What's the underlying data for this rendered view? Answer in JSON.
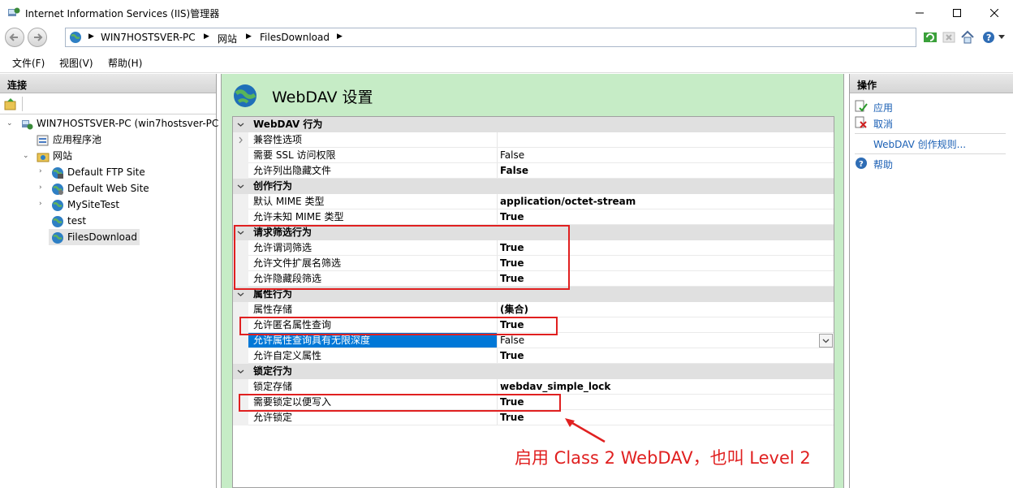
{
  "window": {
    "title": "Internet Information Services (IIS)管理器"
  },
  "address": {
    "crumbs": [
      "WIN7HOSTSVER-PC",
      "网站",
      "FilesDownload"
    ]
  },
  "menu": [
    "文件(F)",
    "视图(V)",
    "帮助(H)"
  ],
  "left": {
    "header": "连接",
    "tree": {
      "server": "WIN7HOSTSVER-PC (win7hostsver-PC",
      "apppools": "应用程序池",
      "sites": "网站",
      "site1": "Default FTP Site",
      "site2": "Default Web Site",
      "site3": "MySiteTest",
      "site4": "test",
      "site5": "FilesDownload"
    }
  },
  "main": {
    "title": "WebDAV 设置",
    "rows": [
      {
        "name": "WebDAV 行为",
        "value": "",
        "kind": "category"
      },
      {
        "name": "兼容性选项",
        "value": "",
        "kind": "expand"
      },
      {
        "name": "需要 SSL 访问权限",
        "value": "False",
        "kind": "normal"
      },
      {
        "name": "允许列出隐藏文件",
        "value": "False",
        "kind": "bold"
      },
      {
        "name": "创作行为",
        "value": "",
        "kind": "category"
      },
      {
        "name": "默认 MIME 类型",
        "value": "application/octet-stream",
        "kind": "bold"
      },
      {
        "name": "允许未知 MIME 类型",
        "value": "True",
        "kind": "bold"
      },
      {
        "name": "请求筛选行为",
        "value": "",
        "kind": "category"
      },
      {
        "name": "允许谓词筛选",
        "value": "True",
        "kind": "bold"
      },
      {
        "name": "允许文件扩展名筛选",
        "value": "True",
        "kind": "bold"
      },
      {
        "name": "允许隐藏段筛选",
        "value": "True",
        "kind": "bold"
      },
      {
        "name": "属性行为",
        "value": "",
        "kind": "category"
      },
      {
        "name": "属性存储",
        "value": "(集合)",
        "kind": "bold"
      },
      {
        "name": "允许匿名属性查询",
        "value": "True",
        "kind": "bold"
      },
      {
        "name": "允许属性查询具有无限深度",
        "value": "False",
        "kind": "selected"
      },
      {
        "name": "允许自定义属性",
        "value": "True",
        "kind": "bold"
      },
      {
        "name": "锁定行为",
        "value": "",
        "kind": "category"
      },
      {
        "name": "锁定存储",
        "value": "webdav_simple_lock",
        "kind": "bold"
      },
      {
        "name": "需要锁定以便写入",
        "value": "True",
        "kind": "bold"
      },
      {
        "name": "允许锁定",
        "value": "True",
        "kind": "bold"
      }
    ],
    "annotation": "启用 Class 2 WebDAV，也叫 Level 2"
  },
  "actions": {
    "header": "操作",
    "apply": "应用",
    "cancel": "取消",
    "rules": "WebDAV 创作规则...",
    "help": "帮助"
  },
  "colors": {
    "annotation": "#e02020",
    "center_bg": "#c6ecc6",
    "selection": "#0078d7",
    "link": "#1a5fb4"
  }
}
